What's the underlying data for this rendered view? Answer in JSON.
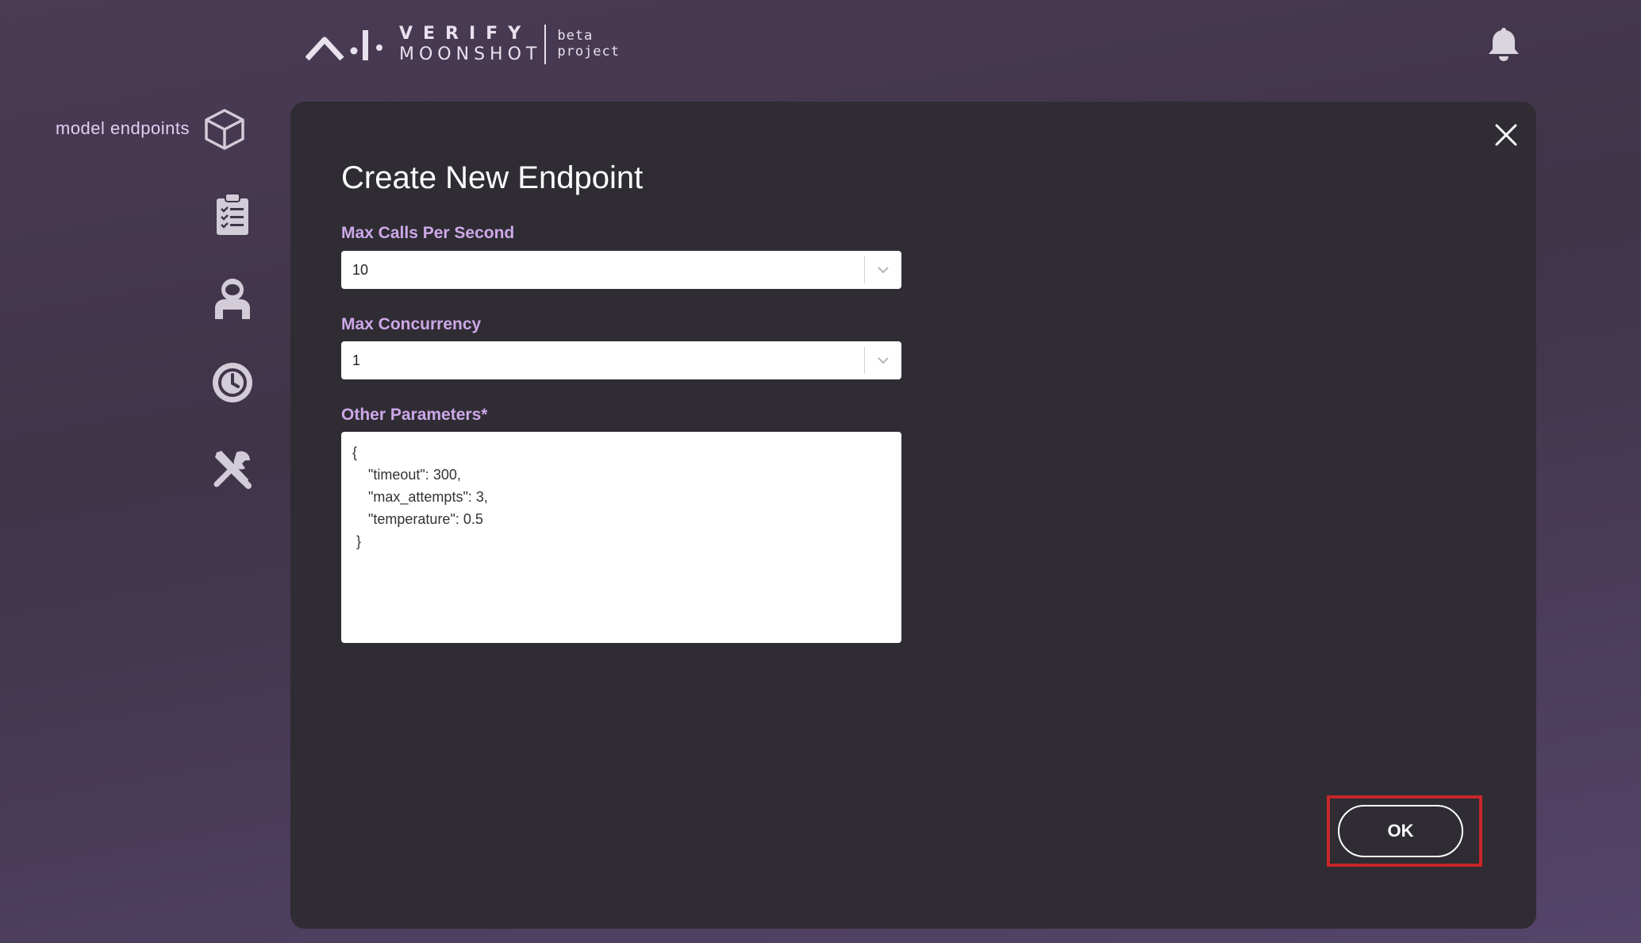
{
  "header": {
    "logo_verify": "VERIFY",
    "logo_moonshot": "MOONSHOT",
    "logo_beta": "beta",
    "logo_project": "project",
    "notification_icon": "bell-icon"
  },
  "sidebar": {
    "items": [
      {
        "label": "model endpoints",
        "icon": "cube-icon"
      },
      {
        "label": "",
        "icon": "clipboard-checklist-icon"
      },
      {
        "label": "",
        "icon": "astronaut-icon"
      },
      {
        "label": "",
        "icon": "history-clock-icon"
      },
      {
        "label": "",
        "icon": "tools-icon"
      }
    ]
  },
  "modal": {
    "title": "Create New Endpoint",
    "close_icon": "close-icon",
    "max_calls": {
      "label": "Max Calls Per Second",
      "value": "10"
    },
    "max_concurrency": {
      "label": "Max Concurrency",
      "value": "1"
    },
    "other_params": {
      "label": "Other Parameters*",
      "value": "{\n    \"timeout\": 300,\n    \"max_attempts\": 3,\n    \"temperature\": 0.5\n }"
    },
    "ok_label": "OK"
  },
  "colors": {
    "accent_label": "#cda8e8",
    "modal_bg": "#2f2c33",
    "highlight": "#c8262a"
  }
}
